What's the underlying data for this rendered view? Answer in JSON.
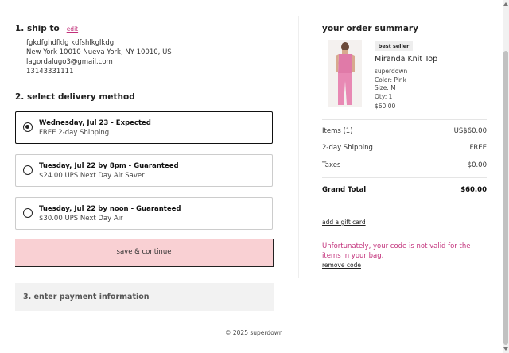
{
  "ship_to": {
    "heading": "1. ship to",
    "edit_label": "edit",
    "address_lines": [
      "fgkdfghdfklg kdfshlkglkdg",
      "New York 10010 Nueva York, NY 10010, US",
      "lagordalugo3@gmail.com",
      "13143331111"
    ]
  },
  "delivery": {
    "heading": "2. select delivery method",
    "options": [
      {
        "title": "Wednesday, Jul 23 - Expected",
        "detail": "FREE 2-day Shipping",
        "selected": true
      },
      {
        "title": "Tuesday, Jul 22 by 8pm - Guaranteed",
        "detail": "$24.00 UPS Next Day Air Saver",
        "selected": false
      },
      {
        "title": "Tuesday, Jul 22 by noon - Guaranteed",
        "detail": "$30.00 UPS Next Day Air",
        "selected": false
      }
    ],
    "save_label": "save & continue"
  },
  "payment": {
    "heading": "3. enter payment information"
  },
  "footer": {
    "copyright": "© 2025 superdown"
  },
  "summary": {
    "title": "your order summary",
    "item": {
      "badge": "best seller",
      "name": "Miranda Knit Top",
      "brand": "superdown",
      "color": "Color: Pink",
      "size": "Size: M",
      "qty": "Qty: 1",
      "price": "$60.00"
    },
    "rows": [
      {
        "label": "Items (1)",
        "value": "US$60.00"
      },
      {
        "label": "2-day Shipping",
        "value": "FREE"
      },
      {
        "label": "Taxes",
        "value": "$0.00"
      }
    ],
    "total": {
      "label": "Grand Total",
      "value": "$60.00"
    },
    "gift_card_label": "add a gift card",
    "error_message": "Unfortunately, your code is not valid for the items in your bag.",
    "remove_code_label": "remove code"
  },
  "colors": {
    "accent": "#c2307a",
    "button_bg": "#f9d0d3"
  }
}
